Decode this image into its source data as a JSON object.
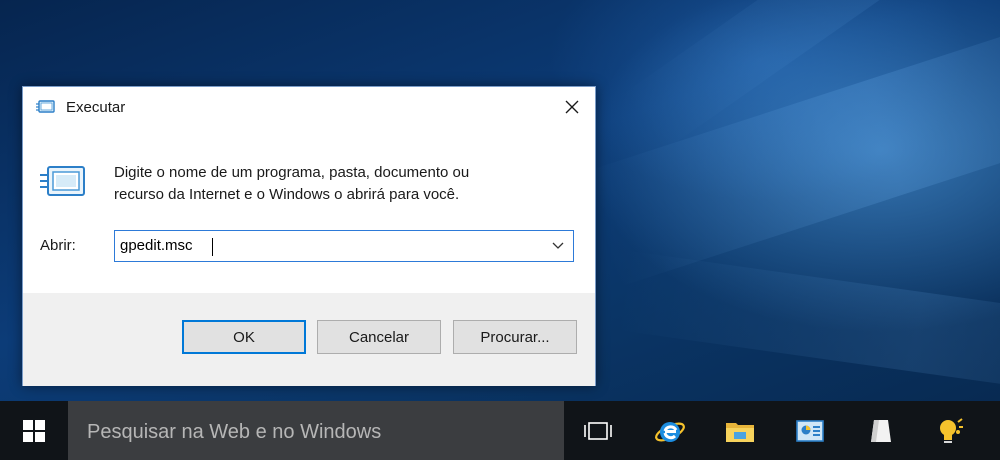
{
  "dialog": {
    "title": "Executar",
    "description_line1": "Digite o nome de um programa, pasta, documento ou",
    "description_line2": "recurso da Internet e o Windows o abrirá para você.",
    "open_label": "Abrir:",
    "open_value": "gpedit.msc",
    "buttons": {
      "ok": "OK",
      "cancel": "Cancelar",
      "browse": "Procurar..."
    }
  },
  "taskbar": {
    "search_placeholder": "Pesquisar na Web e no Windows",
    "icons": [
      "windows-start-icon",
      "task-view-icon",
      "internet-explorer-icon",
      "file-explorer-icon",
      "control-panel-icon",
      "app-icon",
      "tips-icon"
    ]
  },
  "colors": {
    "accent": "#0078d7",
    "taskbar": "#101418",
    "search_box": "#3b3d40"
  }
}
